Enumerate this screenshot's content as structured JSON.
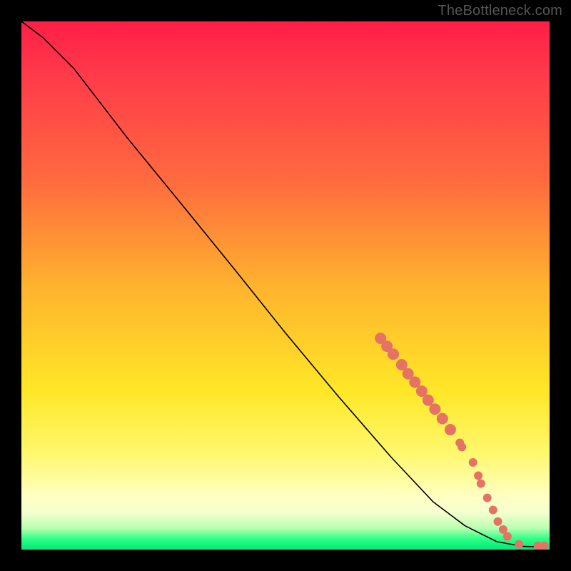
{
  "watermark": "TheBottleneck.com",
  "chart_data": {
    "type": "line",
    "title": "",
    "xlabel": "",
    "ylabel": "",
    "xlim": [
      0,
      100
    ],
    "ylim": [
      0,
      100
    ],
    "curve": [
      {
        "x": 0.0,
        "y": 100.0
      },
      {
        "x": 4.0,
        "y": 97.0
      },
      {
        "x": 10.0,
        "y": 91.0
      },
      {
        "x": 20.0,
        "y": 78.0
      },
      {
        "x": 30.0,
        "y": 65.8
      },
      {
        "x": 40.0,
        "y": 53.5
      },
      {
        "x": 50.0,
        "y": 41.0
      },
      {
        "x": 60.0,
        "y": 29.0
      },
      {
        "x": 70.0,
        "y": 17.5
      },
      {
        "x": 78.0,
        "y": 9.0
      },
      {
        "x": 84.0,
        "y": 4.5
      },
      {
        "x": 90.0,
        "y": 1.5
      },
      {
        "x": 95.0,
        "y": 0.6
      },
      {
        "x": 99.0,
        "y": 0.5
      }
    ],
    "markers": [
      {
        "x": 68.0,
        "y": 40.0,
        "size": "lg"
      },
      {
        "x": 69.2,
        "y": 38.5,
        "size": "lg"
      },
      {
        "x": 70.4,
        "y": 37.0,
        "size": "lg"
      },
      {
        "x": 72.0,
        "y": 35.0,
        "size": "lg"
      },
      {
        "x": 73.2,
        "y": 33.3,
        "size": "lg"
      },
      {
        "x": 74.5,
        "y": 31.7,
        "size": "lg"
      },
      {
        "x": 75.8,
        "y": 30.0,
        "size": "lg"
      },
      {
        "x": 77.0,
        "y": 28.3,
        "size": "lg"
      },
      {
        "x": 78.3,
        "y": 26.6,
        "size": "lg"
      },
      {
        "x": 79.7,
        "y": 24.8,
        "size": "lg"
      },
      {
        "x": 81.2,
        "y": 22.7,
        "size": "lg"
      },
      {
        "x": 83.0,
        "y": 20.2,
        "size": "md"
      },
      {
        "x": 83.4,
        "y": 19.4,
        "size": "md"
      },
      {
        "x": 85.5,
        "y": 16.5,
        "size": "md"
      },
      {
        "x": 86.5,
        "y": 14.0,
        "size": "md"
      },
      {
        "x": 87.0,
        "y": 12.5,
        "size": "md"
      },
      {
        "x": 88.2,
        "y": 9.8,
        "size": "md"
      },
      {
        "x": 89.3,
        "y": 7.5,
        "size": "md"
      },
      {
        "x": 90.2,
        "y": 5.3,
        "size": "md"
      },
      {
        "x": 91.2,
        "y": 3.8,
        "size": "md"
      },
      {
        "x": 92.0,
        "y": 2.5,
        "size": "md"
      },
      {
        "x": 94.2,
        "y": 1.0,
        "size": "md"
      },
      {
        "x": 97.8,
        "y": 0.7,
        "size": "md"
      },
      {
        "x": 99.0,
        "y": 0.7,
        "size": "md"
      }
    ]
  }
}
